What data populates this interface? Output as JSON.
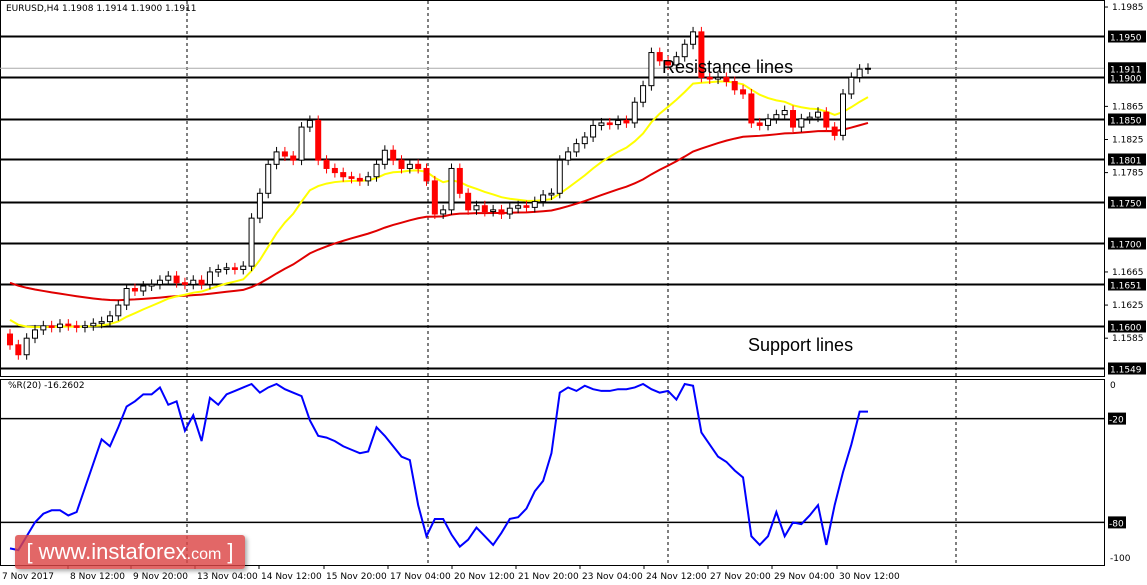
{
  "header": {
    "symbol_label": "EURUSD,H4  1.1908 1.1914 1.1900 1.1911"
  },
  "indicator": {
    "label": "%R(20) -16.2602"
  },
  "annotations": {
    "resistance": "Resistance lines",
    "support": "Support lines"
  },
  "watermark": {
    "left": "[ www.instaforex",
    "domain": ".com",
    "right": " ]"
  },
  "colors": {
    "bull": "#000000",
    "bear": "#ff0000",
    "ma_fast": "#ffff00",
    "ma_slow": "#e00000",
    "wpr": "#0000ff",
    "watermark": "#dc4646"
  },
  "chart_data": {
    "type": "candlestick",
    "title": "EURUSD,H4",
    "ylim": [
      1.1545,
      1.1985
    ],
    "price_ticks": [
      "1.1985",
      "1.1865",
      "1.1825",
      "1.1785",
      "1.1665",
      "1.1625",
      "1.1585"
    ],
    "current_price": "1.1911",
    "level_lines": [
      "1.1950",
      "1.1900",
      "1.1850",
      "1.1801",
      "1.1750",
      "1.1700",
      "1.1651",
      "1.1600",
      "1.1549"
    ],
    "x_labels": [
      "7 Nov 2017",
      "8 Nov 12:00",
      "9 Nov 20:00",
      "13 Nov 04:00",
      "14 Nov 12:00",
      "15 Nov 20:00",
      "17 Nov 04:00",
      "20 Nov 12:00",
      "21 Nov 20:00",
      "23 Nov 04:00",
      "24 Nov 12:00",
      "27 Nov 20:00",
      "29 Nov 04:00",
      "30 Nov 12:00"
    ],
    "first_open": 1.159,
    "closes": [
      1.1577,
      1.1565,
      1.1585,
      1.1595,
      1.16,
      1.1598,
      1.1602,
      1.16,
      1.1598,
      1.16,
      1.1603,
      1.1605,
      1.1612,
      1.1625,
      1.1645,
      1.1642,
      1.1648,
      1.165,
      1.1655,
      1.166,
      1.1652,
      1.165,
      1.1655,
      1.165,
      1.1665,
      1.1668,
      1.167,
      1.1668,
      1.1672,
      1.173,
      1.176,
      1.1795,
      1.181,
      1.1805,
      1.18,
      1.184,
      1.1848,
      1.18,
      1.179,
      1.1785,
      1.178,
      1.1778,
      1.1775,
      1.178,
      1.1795,
      1.1812,
      1.18,
      1.179,
      1.1795,
      1.179,
      1.1775,
      1.1735,
      1.174,
      1.179,
      1.176,
      1.174,
      1.1745,
      1.1738,
      1.174,
      1.1735,
      1.1742,
      1.1745,
      1.1743,
      1.175,
      1.1758,
      1.176,
      1.18,
      1.181,
      1.182,
      1.1828,
      1.1842,
      1.1845,
      1.1843,
      1.1848,
      1.1845,
      1.187,
      1.189,
      1.193,
      1.192,
      1.1915,
      1.1925,
      1.194,
      1.1955,
      1.19,
      1.1898,
      1.19,
      1.1895,
      1.1885,
      1.188,
      1.1845,
      1.1842,
      1.185,
      1.1855,
      1.186,
      1.184,
      1.185,
      1.1852,
      1.1858,
      1.184,
      1.183,
      1.188,
      1.19,
      1.191,
      1.1911
    ],
    "ma_fast": {
      "name": "MA fast (yellow)",
      "seed": 1.1612,
      "alpha": 0.14
    },
    "ma_slow": {
      "name": "MA slow (red)",
      "seed": 1.1655,
      "alpha": 0.04
    },
    "wpr": {
      "name": "%R(20)",
      "ylim": [
        -100,
        0
      ],
      "levels": [
        "-20",
        "-80"
      ],
      "ticks": [
        "0",
        "-20",
        "-80",
        "-100"
      ],
      "values": [
        -95,
        -96,
        -88,
        -80,
        -75,
        -73,
        -73,
        -76,
        -74,
        -60,
        -46,
        -32,
        -36,
        -25,
        -13,
        -10,
        -6,
        -6,
        -2,
        -12,
        -10,
        -27,
        -18,
        -33,
        -8,
        -12,
        -6,
        -4,
        -2,
        0,
        -5,
        -2,
        0,
        -3,
        -5,
        -7,
        -21,
        -30,
        -31,
        -33,
        -36,
        -38,
        -40,
        -39,
        -25,
        -30,
        -36,
        -42,
        -44,
        -70,
        -88,
        -78,
        -78,
        -87,
        -94,
        -90,
        -83,
        -88,
        -93,
        -86,
        -78,
        -77,
        -72,
        -62,
        -56,
        -40,
        -5,
        -2,
        -4,
        -1,
        -3,
        -4,
        -4,
        -3,
        -3,
        -2,
        0,
        -3,
        -5,
        -4,
        -9,
        0,
        -1,
        -28,
        -35,
        -42,
        -45,
        -50,
        -54,
        -88,
        -93,
        -88,
        -74,
        -88,
        -80,
        -81,
        -76,
        -70,
        -93,
        -70,
        -51,
        -35,
        -16,
        -16
      ]
    }
  }
}
